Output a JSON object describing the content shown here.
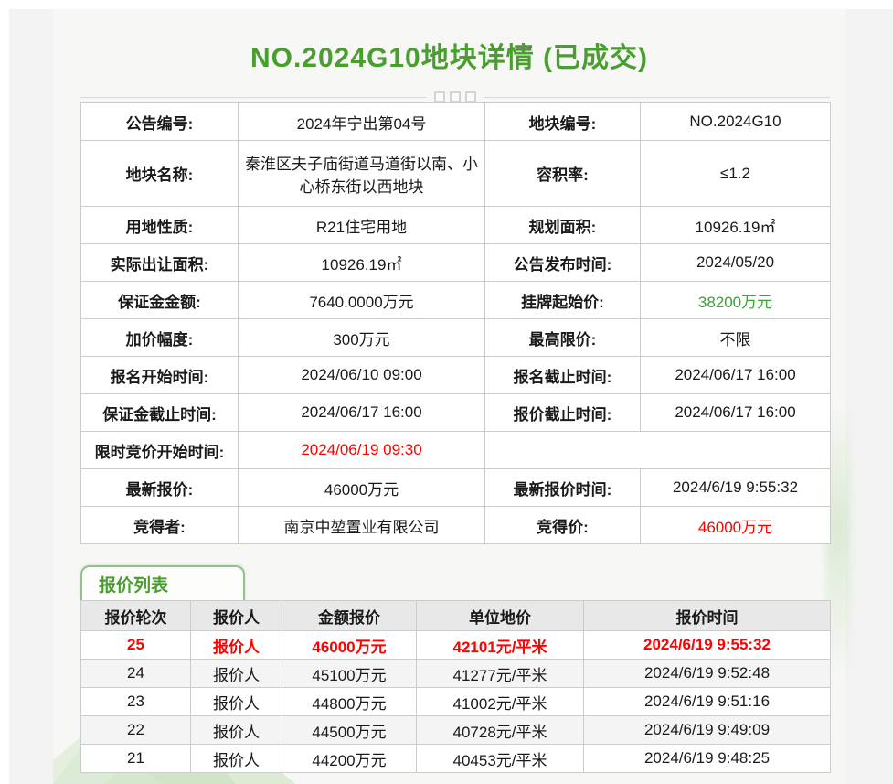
{
  "header": {
    "title": "NO.2024G10地块详情 (已成交)"
  },
  "colors": {
    "accent_green": "#4a9e30",
    "price_green": "#3aa336",
    "alert_red": "#ff0000"
  },
  "details": {
    "rows": [
      {
        "l1": "公告编号:",
        "v1": "2024年宁出第04号",
        "l2": "地块编号:",
        "v2": "NO.2024G10"
      },
      {
        "l1": "地块名称:",
        "v1": "秦淮区夫子庙街道马道街以南、小心桥东街以西地块",
        "l2": "容积率:",
        "v2": "≤1.2"
      },
      {
        "l1": "用地性质:",
        "v1": "R21住宅用地",
        "l2": "规划面积:",
        "v2": "10926.19㎡"
      },
      {
        "l1": "实际出让面积:",
        "v1": "10926.19㎡",
        "l2": "公告发布时间:",
        "v2": "2024/05/20"
      },
      {
        "l1": "保证金金额:",
        "v1": "7640.0000万元",
        "l2": "挂牌起始价:",
        "v2": "38200万元"
      },
      {
        "l1": "加价幅度:",
        "v1": "300万元",
        "l2": "最高限价:",
        "v2": "不限"
      },
      {
        "l1": "报名开始时间:",
        "v1": "2024/06/10 09:00",
        "l2": "报名截止时间:",
        "v2": "2024/06/17 16:00"
      },
      {
        "l1": "保证金截止时间:",
        "v1": "2024/06/17 16:00",
        "l2": "报价截止时间:",
        "v2": "2024/06/17 16:00"
      },
      {
        "l1": "限时竞价开始时间:",
        "v1": "2024/06/19 09:30",
        "l2": "",
        "v2": ""
      },
      {
        "l1": "最新报价:",
        "v1": "46000万元",
        "l2": "最新报价时间:",
        "v2": "2024/6/19 9:55:32"
      },
      {
        "l1": "竞得者:",
        "v1": "南京中堃置业有限公司",
        "l2": "竞得价:",
        "v2": "46000万元"
      }
    ]
  },
  "bid_section": {
    "tab_label": "报价列表",
    "columns": [
      "报价轮次",
      "报价人",
      "金额报价",
      "单位地价",
      "报价时间"
    ],
    "rows": [
      {
        "round": "25",
        "bidder": "报价人",
        "amount": "46000万元",
        "unit_price": "42101元/平米",
        "time": "2024/6/19 9:55:32"
      },
      {
        "round": "24",
        "bidder": "报价人",
        "amount": "45100万元",
        "unit_price": "41277元/平米",
        "time": "2024/6/19 9:52:48"
      },
      {
        "round": "23",
        "bidder": "报价人",
        "amount": "44800万元",
        "unit_price": "41002元/平米",
        "time": "2024/6/19 9:51:16"
      },
      {
        "round": "22",
        "bidder": "报价人",
        "amount": "44500万元",
        "unit_price": "40728元/平米",
        "time": "2024/6/19 9:49:09"
      },
      {
        "round": "21",
        "bidder": "报价人",
        "amount": "44200万元",
        "unit_price": "40453元/平米",
        "time": "2024/6/19 9:48:25"
      }
    ]
  }
}
